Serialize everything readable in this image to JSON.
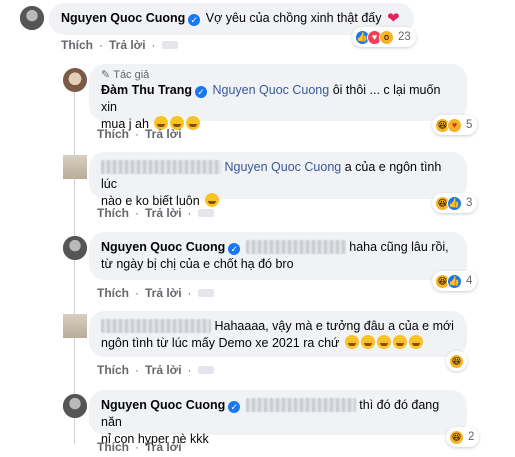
{
  "comments": [
    {
      "author": "Nguyen Quoc Cuong",
      "text": "Vợ yêu của chồng xinh thật đấy",
      "actions": {
        "like": "Thích",
        "reply": "Trả lời"
      },
      "reaction_count": "23",
      "reactions": [
        "like-icon",
        "love-icon",
        "wow-icon"
      ]
    },
    {
      "badge": "Tác giả",
      "author": "Đàm Thu Trang",
      "mention": "Nguyen Quoc Cuong",
      "text_line1": "ôi thôi ... c lại muốn xin",
      "text_line2": "mua j ah",
      "actions": {
        "like": "Thích",
        "reply": "Trả lời"
      },
      "reaction_count": "5",
      "reactions": [
        "haha-icon",
        "care-icon"
      ]
    },
    {
      "mention": "Nguyen Quoc Cuong",
      "text_line1": "a của e ngôn tình lúc",
      "text_line2": "nào e ko biết luôn",
      "actions": {
        "like": "Thích",
        "reply": "Trả lời"
      },
      "reaction_count": "3",
      "reactions": [
        "haha-icon",
        "like-icon"
      ]
    },
    {
      "author": "Nguyen Quoc Cuong",
      "text_line1": "haha cũng lâu rồi,",
      "text_line2": "từ ngày bị chị của e chốt hạ đó bro",
      "actions": {
        "like": "Thích",
        "reply": "Trả lời"
      },
      "reaction_count": "4",
      "reactions": [
        "haha-icon",
        "like-icon"
      ]
    },
    {
      "text_line1": "Hahaaaa, vậy mà e tưởng đâu a của e mới",
      "text_line2": "ngôn tình từ lúc mấy Demo xe 2021 ra chứ",
      "actions": {
        "like": "Thích",
        "reply": "Trả lời"
      },
      "reaction_count": "",
      "reactions": [
        "haha-icon"
      ]
    },
    {
      "author": "Nguyen Quoc Cuong",
      "text_line1": "thì đó đó đang năn",
      "text_line2": "nỉ con hyper nè kkk",
      "actions": {
        "like": "Thích",
        "reply": "Trả lời"
      },
      "reaction_count": "2",
      "reactions": [
        "haha-icon"
      ]
    }
  ],
  "colors": {
    "bubble": "#f0f2f5",
    "verified": "#1877f2",
    "mention": "#385898",
    "meta": "#65676b"
  }
}
